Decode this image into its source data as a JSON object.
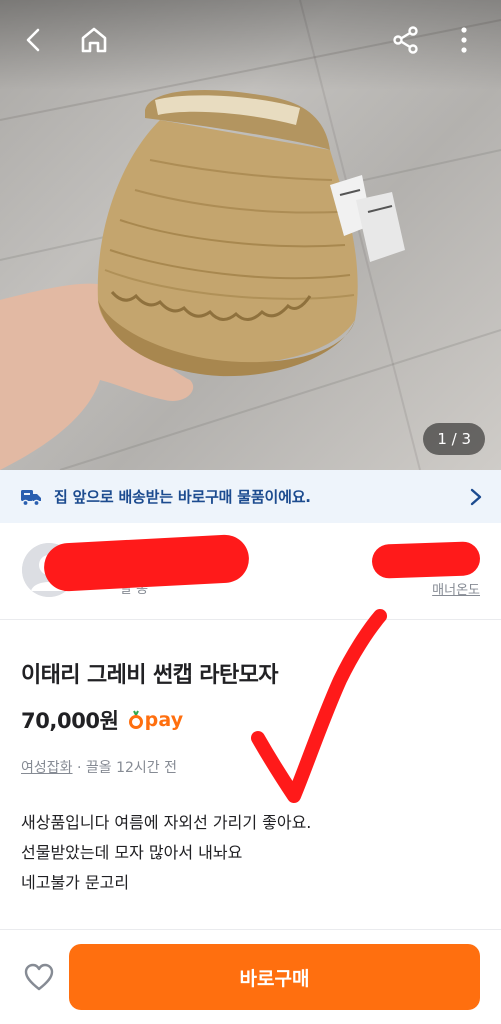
{
  "header": {
    "back_icon": "chevron-left-icon",
    "home_icon": "home-icon",
    "share_icon": "share-icon",
    "more_icon": "more-vertical-icon",
    "image_counter": "1 / 3"
  },
  "banner": {
    "icon": "delivery-truck-icon",
    "text": "집 앞으로 배송받는 바로구매 물품이에요.",
    "arrow_icon": "chevron-right-icon"
  },
  "seller": {
    "location_partial": "날 동",
    "manner_label": "매너온도"
  },
  "product": {
    "title": "이태리 그레비 썬캡 라탄모자",
    "price": "70,000원",
    "pay_label": "pay",
    "category": "여성잡화",
    "meta_separator": " · ",
    "time": "끌올 12시간 전",
    "description": [
      "새상품입니다 여름에 자외선 가리기 좋아요.",
      "선물받았는데 모자 많아서 내놔요",
      "네고불가 문고리"
    ]
  },
  "bottom_bar": {
    "like_icon": "heart-outline-icon",
    "buy_label": "바로구매"
  },
  "colors": {
    "brand_orange": "#ff6f0f",
    "banner_bg": "#eef4fb",
    "banner_text": "#1c4b8f",
    "redaction": "#ff1a1a"
  }
}
